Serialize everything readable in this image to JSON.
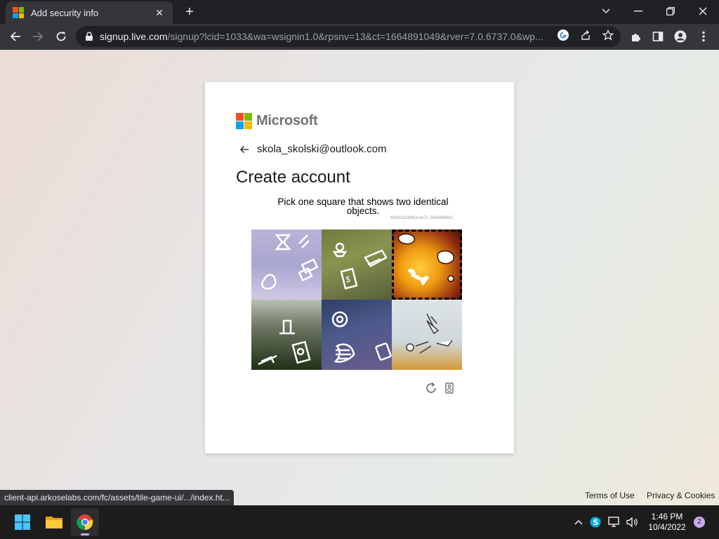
{
  "browser": {
    "tab_title": "Add security info",
    "url_host": "signup.live.com",
    "url_path": "/signup?lcid=1033&wa=wsignin1.0&rpsnv=13&ct=1664891049&rver=7.0.6737.0&wp..."
  },
  "card": {
    "brand": "Microsoft",
    "identity": "skola_skolski@outlook.com",
    "heading": "Create account",
    "instruction": "Pick one square that shows two identical objects.",
    "session_id": "930633c3bf62c4e71.2643868601"
  },
  "footer": {
    "terms": "Terms of Use",
    "privacy": "Privacy & Cookies"
  },
  "status_url": "client-api.arkoselabs.com/fc/assets/tile-game-ui/.../index.ht...",
  "taskbar": {
    "time": "1:46 PM",
    "date": "10/4/2022",
    "notifications": "2"
  }
}
